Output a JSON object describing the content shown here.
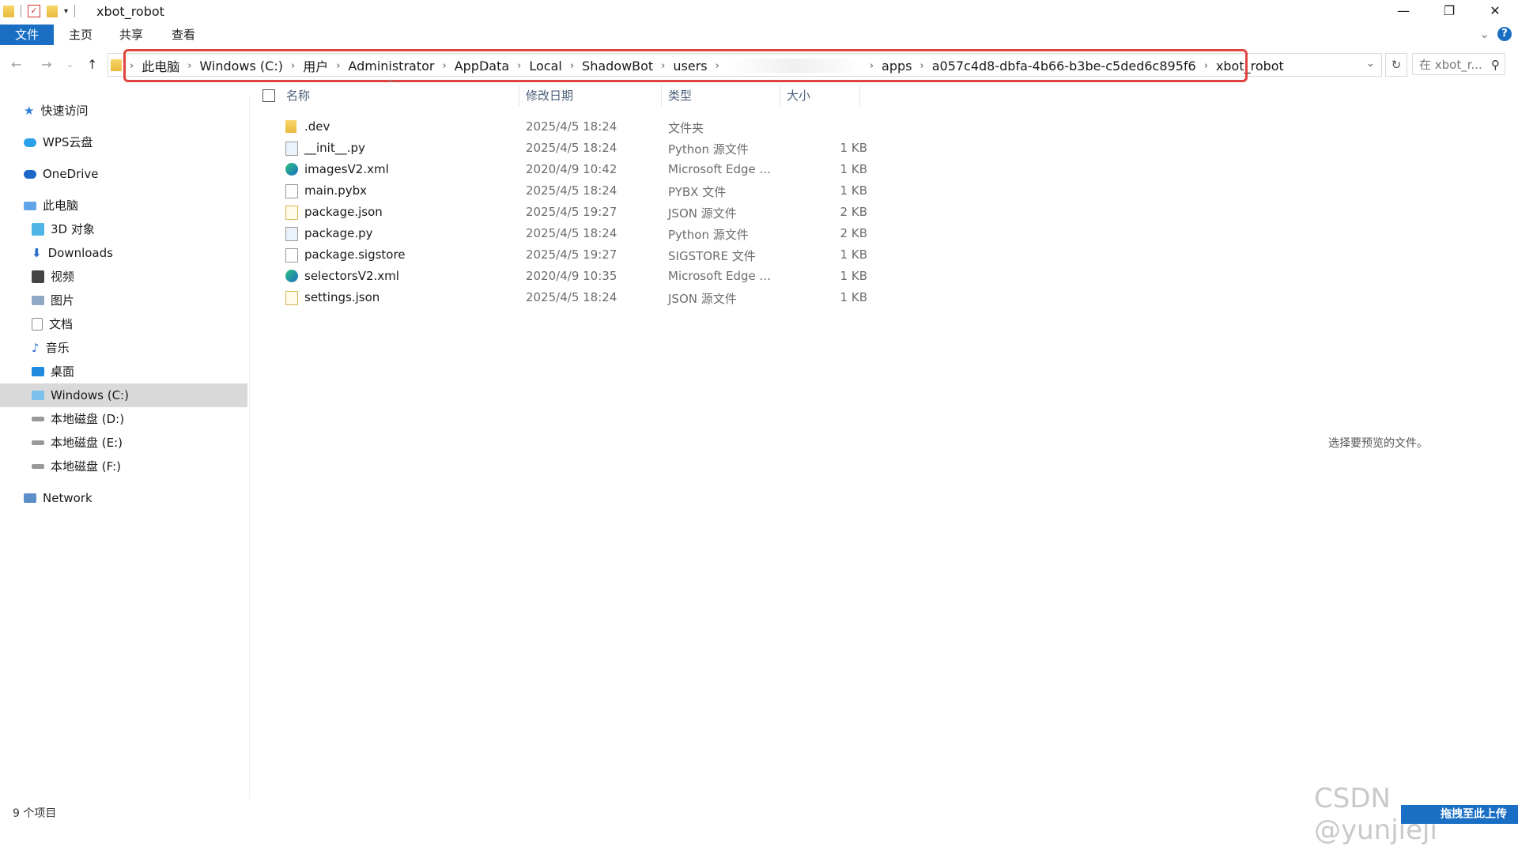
{
  "window": {
    "title": "xbot_robot"
  },
  "ribbon": {
    "tabs": [
      "文件",
      "主页",
      "共享",
      "查看"
    ]
  },
  "address": {
    "crumbs": [
      "此电脑",
      "Windows (C:)",
      "用户",
      "Administrator",
      "AppData",
      "Local",
      "ShadowBot",
      "users",
      "apps",
      "a057c4d8-dbfa-4b66-b3be-c5ded6c895f6",
      "xbot_robot"
    ],
    "search_placeholder": "在 xbot_r..."
  },
  "nav": {
    "items": [
      "快速访问",
      "WPS云盘",
      "OneDrive",
      "此电脑",
      "3D 对象",
      "Downloads",
      "视频",
      "图片",
      "文档",
      "音乐",
      "桌面",
      "Windows (C:)",
      "本地磁盘 (D:)",
      "本地磁盘 (E:)",
      "本地磁盘 (F:)",
      "Network"
    ],
    "selected": "Windows (C:)"
  },
  "columns": {
    "name": "名称",
    "date": "修改日期",
    "type": "类型",
    "size": "大小"
  },
  "files": [
    {
      "name": ".dev",
      "date": "2025/4/5 18:24",
      "type": "文件夹",
      "size": "",
      "icon": "folder-icon"
    },
    {
      "name": "__init__.py",
      "date": "2025/4/5 18:24",
      "type": "Python 源文件",
      "size": "1 KB",
      "icon": "python-file-icon"
    },
    {
      "name": "imagesV2.xml",
      "date": "2020/4/9 10:42",
      "type": "Microsoft Edge ...",
      "size": "1 KB",
      "icon": "edge-icon"
    },
    {
      "name": "main.pybx",
      "date": "2025/4/5 18:24",
      "type": "PYBX 文件",
      "size": "1 KB",
      "icon": "file-icon"
    },
    {
      "name": "package.json",
      "date": "2025/4/5 19:27",
      "type": "JSON 源文件",
      "size": "2 KB",
      "icon": "json-file-icon"
    },
    {
      "name": "package.py",
      "date": "2025/4/5 18:24",
      "type": "Python 源文件",
      "size": "2 KB",
      "icon": "python-file-icon"
    },
    {
      "name": "package.sigstore",
      "date": "2025/4/5 19:27",
      "type": "SIGSTORE 文件",
      "size": "1 KB",
      "icon": "file-icon"
    },
    {
      "name": "selectorsV2.xml",
      "date": "2020/4/9 10:35",
      "type": "Microsoft Edge ...",
      "size": "1 KB",
      "icon": "edge-icon"
    },
    {
      "name": "settings.json",
      "date": "2025/4/5 18:24",
      "type": "JSON 源文件",
      "size": "1 KB",
      "icon": "json-file-icon"
    }
  ],
  "preview": {
    "text": "选择要预览的文件。"
  },
  "status": {
    "count": "9 个项目"
  },
  "watermark": {
    "text": "CSDN @yunjieji"
  },
  "upload": {
    "label": "拖拽至此上传"
  },
  "colors": {
    "accent": "#1a6fc4",
    "highlight": "#e0443e",
    "selected": "#d9d9d9"
  }
}
